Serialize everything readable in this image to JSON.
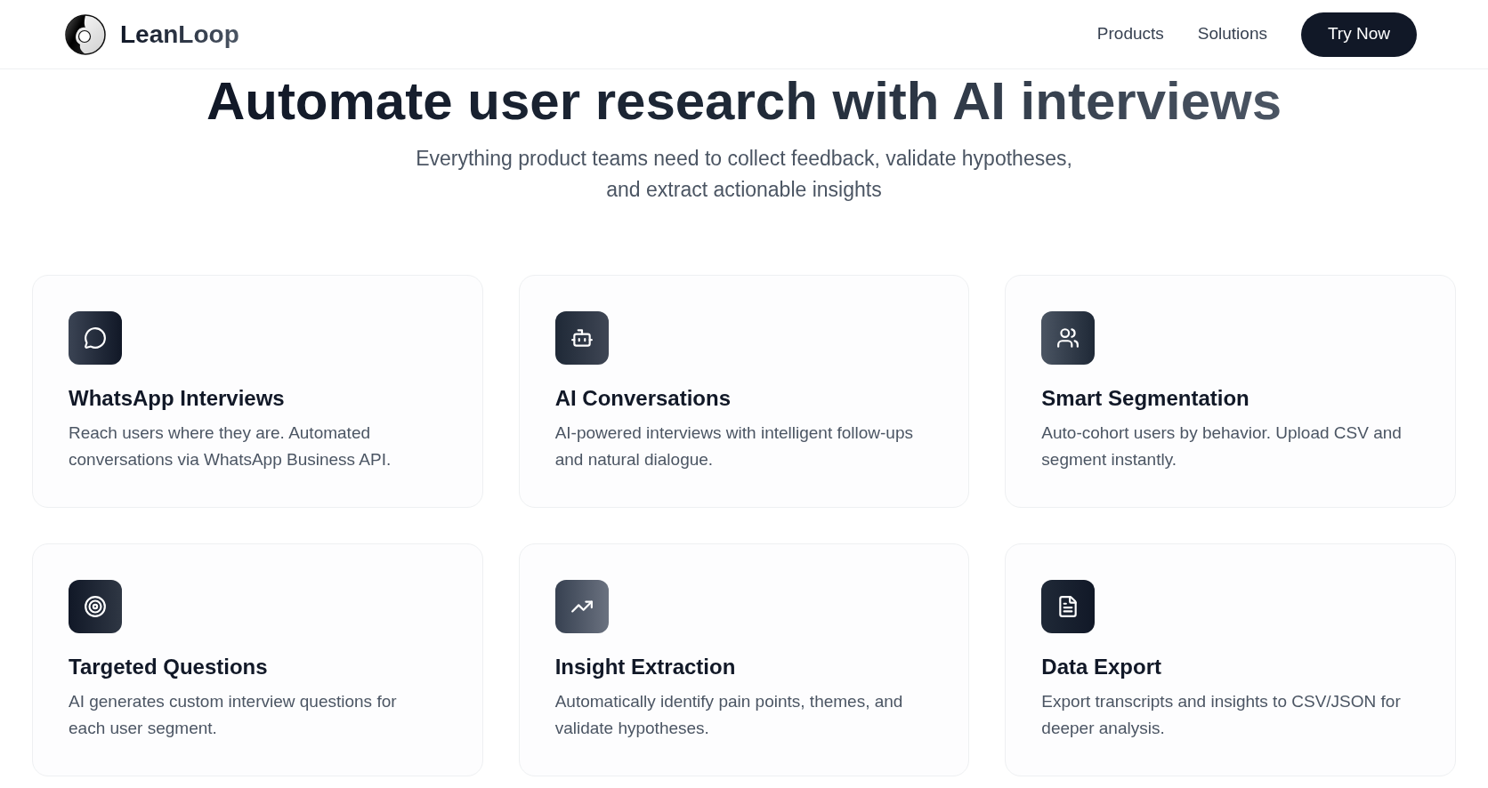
{
  "header": {
    "brand": "LeanLoop",
    "nav": [
      "Products",
      "Solutions"
    ],
    "cta": "Try Now"
  },
  "hero": {
    "title": "Automate user research with AI interviews",
    "subtitle": "Everything product teams need to collect feedback, validate hypotheses, and extract actionable insights"
  },
  "features": [
    {
      "title": "WhatsApp Interviews",
      "description": "Reach users where they are. Automated conversations via WhatsApp Business API."
    },
    {
      "title": "AI Conversations",
      "description": "AI-powered interviews with intelligent follow-ups and natural dialogue."
    },
    {
      "title": "Smart Segmentation",
      "description": "Auto-cohort users by behavior. Upload CSV and segment instantly."
    },
    {
      "title": "Targeted Questions",
      "description": "AI generates custom interview questions for each user segment."
    },
    {
      "title": "Insight Extraction",
      "description": "Automatically identify pain points, themes, and validate hypotheses."
    },
    {
      "title": "Data Export",
      "description": "Export transcripts and insights to CSV/JSON for deeper analysis."
    }
  ]
}
